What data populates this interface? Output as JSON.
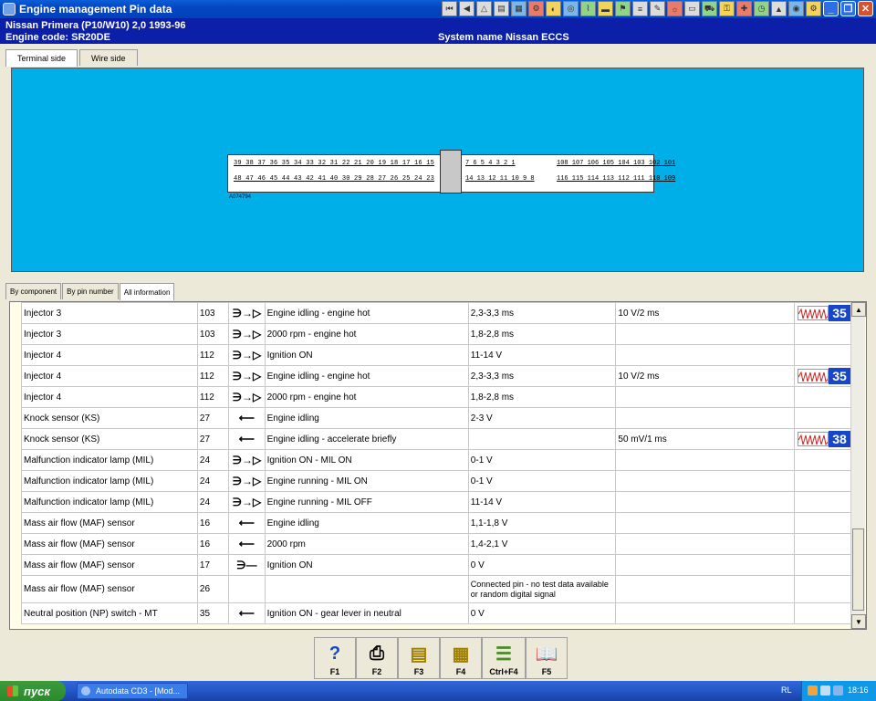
{
  "window": {
    "title": "Engine management Pin data"
  },
  "header": {
    "vehicle": "Nissan  Primera (P10/W10) 2,0  1993-96",
    "engine_code": "Engine code: SR20DE",
    "system_name": "System name Nissan ECCS"
  },
  "top_tabs": [
    {
      "label": "Terminal side",
      "active": true
    },
    {
      "label": "Wire side",
      "active": false
    }
  ],
  "connector": {
    "row1_left": "39 38 37 36 35 34 33 32 31   22 21 20 19 18 17 16 15",
    "row2_left": "48 47 46 45 44 43 42 41 40   30 29 28 27 26 25 24 23",
    "row1_mid": "7  6  5  4  3  2  1",
    "row2_mid": "14 13 12 11 10  9  8",
    "row1_right": "108 107 106 105 104 103 102 101",
    "row2_right": "116 115 114 113 112 111 110 109",
    "part_no": "A074794"
  },
  "mid_tabs": [
    {
      "label": "By component",
      "active": false
    },
    {
      "label": "By pin number",
      "active": false
    },
    {
      "label": "All information",
      "active": true
    }
  ],
  "rows": [
    {
      "component": "Injector 3",
      "pin": "103",
      "sym": "out",
      "condition": "Engine idling - engine hot",
      "value": "2,3-3,3 ms",
      "wave": "10 V/2 ms",
      "osc": "35"
    },
    {
      "component": "Injector 3",
      "pin": "103",
      "sym": "out",
      "condition": "2000 rpm - engine hot",
      "value": "1,8-2,8 ms",
      "wave": "",
      "osc": ""
    },
    {
      "component": "Injector 4",
      "pin": "112",
      "sym": "out",
      "condition": "Ignition ON",
      "value": "11-14 V",
      "wave": "",
      "osc": ""
    },
    {
      "component": "Injector 4",
      "pin": "112",
      "sym": "out",
      "condition": "Engine idling - engine hot",
      "value": "2,3-3,3 ms",
      "wave": "10 V/2 ms",
      "osc": "35"
    },
    {
      "component": "Injector 4",
      "pin": "112",
      "sym": "out",
      "condition": "2000 rpm - engine hot",
      "value": "1,8-2,8 ms",
      "wave": "",
      "osc": ""
    },
    {
      "component": "Knock sensor (KS)",
      "pin": "27",
      "sym": "in",
      "condition": "Engine idling",
      "value": "2-3 V",
      "wave": "",
      "osc": ""
    },
    {
      "component": "Knock sensor (KS)",
      "pin": "27",
      "sym": "in",
      "condition": "Engine idling - accelerate briefly",
      "value": "",
      "wave": "50 mV/1 ms",
      "osc": "38"
    },
    {
      "component": "Malfunction indicator lamp (MIL)",
      "pin": "24",
      "sym": "out",
      "condition": "Ignition ON - MIL ON",
      "value": "0-1 V",
      "wave": "",
      "osc": ""
    },
    {
      "component": "Malfunction indicator lamp (MIL)",
      "pin": "24",
      "sym": "out",
      "condition": "Engine running - MIL ON",
      "value": "0-1 V",
      "wave": "",
      "osc": ""
    },
    {
      "component": "Malfunction indicator lamp (MIL)",
      "pin": "24",
      "sym": "out",
      "condition": "Engine running - MIL OFF",
      "value": "11-14 V",
      "wave": "",
      "osc": ""
    },
    {
      "component": "Mass air flow (MAF) sensor",
      "pin": "16",
      "sym": "in",
      "condition": "Engine idling",
      "value": "1,1-1,8 V",
      "wave": "",
      "osc": ""
    },
    {
      "component": "Mass air flow (MAF) sensor",
      "pin": "16",
      "sym": "in",
      "condition": "2000 rpm",
      "value": "1,4-2,1 V",
      "wave": "",
      "osc": ""
    },
    {
      "component": "Mass air flow (MAF) sensor",
      "pin": "17",
      "sym": "ground",
      "condition": "Ignition ON",
      "value": "0 V",
      "wave": "",
      "osc": ""
    },
    {
      "component": "Mass air flow (MAF) sensor",
      "pin": "26",
      "sym": "",
      "condition": "",
      "value": "Connected pin - no test data available or random digital signal",
      "wave": "",
      "osc": "",
      "tall": true
    },
    {
      "component": "Neutral position (NP) switch - MT",
      "pin": "35",
      "sym": "in",
      "condition": "Ignition ON - gear lever in neutral",
      "value": "0 V",
      "wave": "",
      "osc": ""
    }
  ],
  "symbols": {
    "out": "∋→▷",
    "in": "⟵",
    "ground": "∋—"
  },
  "fkeys": [
    {
      "icon": "help-icon",
      "glyph": "?",
      "label": "F1"
    },
    {
      "icon": "print-icon",
      "glyph": "⎙",
      "label": "F2"
    },
    {
      "icon": "print-preview-icon",
      "glyph": "▤",
      "label": "F3"
    },
    {
      "icon": "copy-icon",
      "glyph": "▦",
      "label": "F4"
    },
    {
      "icon": "list-icon",
      "glyph": "☰",
      "label": "Ctrl+F4"
    },
    {
      "icon": "book-icon",
      "glyph": "📖",
      "label": "F5"
    }
  ],
  "taskbar": {
    "start_label": "пуск",
    "task_label": "Autodata CD3 - [Mod...",
    "lang": "RL",
    "time": "18:16"
  },
  "colors": {
    "diagram_bg": "#00aee8",
    "title_bar": "#0346c1",
    "info_bar": "#0b1fa8",
    "osc_badge": "#1846c8"
  }
}
